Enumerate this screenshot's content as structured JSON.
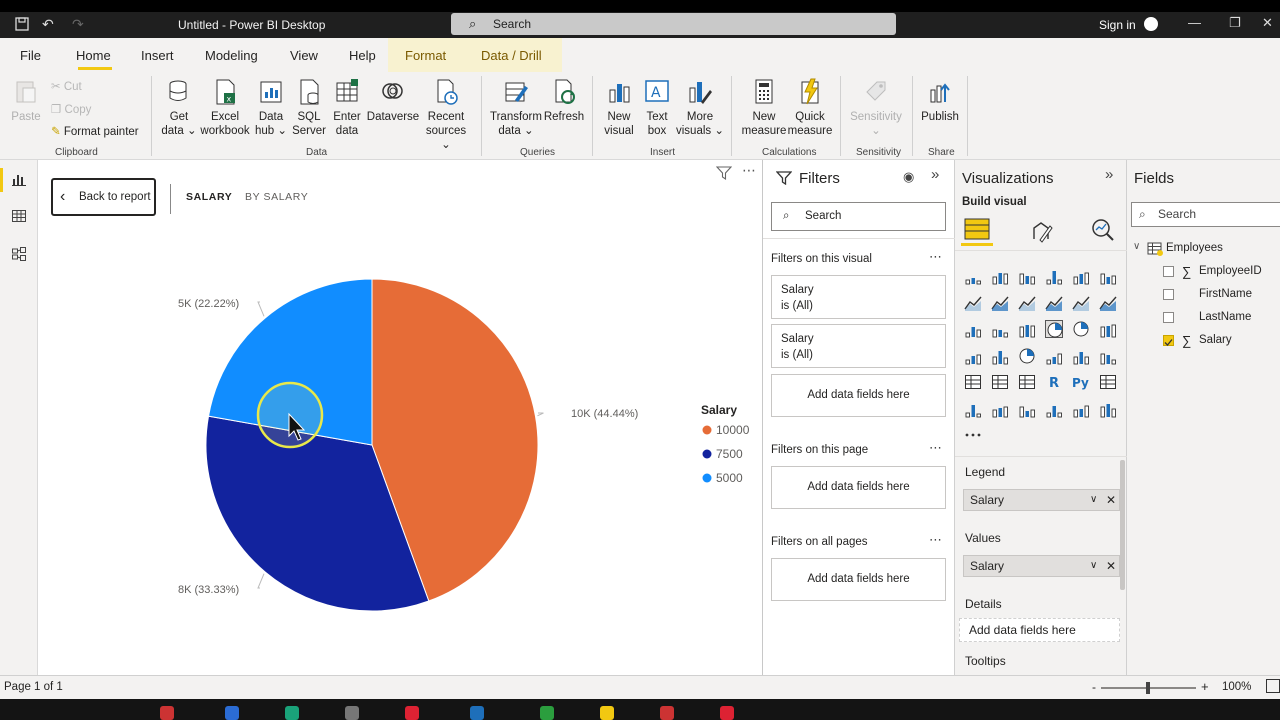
{
  "window": {
    "title": "Untitled - Power BI Desktop",
    "search_label": "Search",
    "sign_in": "Sign in"
  },
  "menu": {
    "file": "File",
    "home": "Home",
    "insert": "Insert",
    "modeling": "Modeling",
    "view": "View",
    "help": "Help",
    "format": "Format",
    "data_drill": "Data / Drill"
  },
  "ribbon": {
    "clipboard": {
      "paste": "Paste",
      "cut": "Cut",
      "copy": "Copy",
      "format_painter": "Format painter",
      "group": "Clipboard"
    },
    "data": {
      "get_data_1": "Get",
      "get_data_2": "data",
      "excel_1": "Excel",
      "excel_2": "workbook",
      "hub_1": "Data",
      "hub_2": "hub",
      "sql_1": "SQL",
      "sql_2": "Server",
      "enter_1": "Enter",
      "enter_2": "data",
      "dataverse": "Dataverse",
      "recent_1": "Recent",
      "recent_2": "sources",
      "group": "Data"
    },
    "queries": {
      "transform_1": "Transform",
      "transform_2": "data",
      "refresh": "Refresh",
      "group": "Queries"
    },
    "insert": {
      "new_visual_1": "New",
      "new_visual_2": "visual",
      "text_box_1": "Text",
      "text_box_2": "box",
      "more_1": "More",
      "more_2": "visuals",
      "group": "Insert"
    },
    "calculations": {
      "new_measure_1": "New",
      "new_measure_2": "measure",
      "quick_1": "Quick",
      "quick_2": "measure",
      "group": "Calculations"
    },
    "sensitivity": {
      "label": "Sensitivity",
      "group": "Sensitivity"
    },
    "share": {
      "publish": "Publish",
      "group": "Share"
    }
  },
  "canvas": {
    "back_button": "Back to report",
    "tab_salary": "SALARY",
    "tab_by_salary": "BY SALARY"
  },
  "chart_data": {
    "type": "pie",
    "categories": [
      "10000",
      "7500",
      "5000"
    ],
    "values": [
      10000,
      7500,
      5000
    ],
    "data_labels": [
      "10K (44.44%)",
      "8K (33.33%)",
      "5K (22.22%)"
    ],
    "colors": [
      "#e66c37",
      "#12239e",
      "#118dff"
    ],
    "legend_title": "Salary",
    "legend_position": "right",
    "start_angle_deg": 0
  },
  "filters": {
    "title": "Filters",
    "search": "Search",
    "on_visual": "Filters on this visual",
    "card1_field": "Salary",
    "card1_state": "is (All)",
    "card2_field": "Salary",
    "card2_state": "is (All)",
    "add_fields_visual": "Add data fields here",
    "on_page": "Filters on this page",
    "add_fields_page": "Add data fields here",
    "on_all": "Filters on all pages",
    "add_fields_all": "Add data fields here"
  },
  "visualizations": {
    "title": "Visualizations",
    "build": "Build visual",
    "legend_label": "Legend",
    "legend_field": "Salary",
    "values_label": "Values",
    "values_field": "Salary",
    "details_label": "Details",
    "details_add": "Add data fields here",
    "tooltips_label": "Tooltips"
  },
  "fields": {
    "title": "Fields",
    "search": "Search",
    "table": "Employees",
    "items": [
      {
        "name": "EmployeeID",
        "sigma": true,
        "checked": false
      },
      {
        "name": "FirstName",
        "sigma": false,
        "checked": false
      },
      {
        "name": "LastName",
        "sigma": false,
        "checked": false
      },
      {
        "name": "Salary",
        "sigma": true,
        "checked": true
      }
    ]
  },
  "status": {
    "page": "Page 1 of 1",
    "zoom": "100%"
  },
  "colors": {
    "accent": "#f2c811",
    "ribbon_bg": "#f3f2f1",
    "titlebar_bg": "#1f1f1f"
  }
}
